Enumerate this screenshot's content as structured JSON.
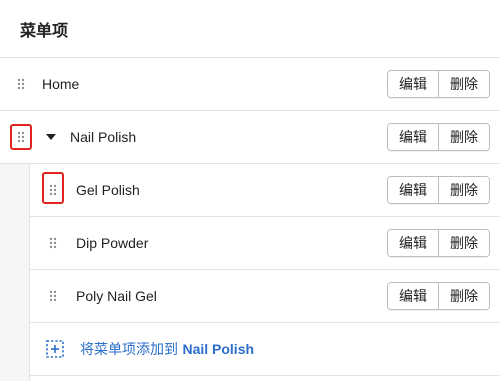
{
  "header": {
    "title": "菜单项"
  },
  "actions": {
    "edit_label": "编辑",
    "delete_label": "删除"
  },
  "items": [
    {
      "label": "Home",
      "level": 0,
      "expanded": false
    },
    {
      "label": "Nail Polish",
      "level": 0,
      "expanded": true
    },
    {
      "label": "Gel Polish",
      "level": 1
    },
    {
      "label": "Dip Powder",
      "level": 1
    },
    {
      "label": "Poly Nail Gel",
      "level": 1
    }
  ],
  "add_item": {
    "prefix": "将菜单项添加到 ",
    "target": "Nail Polish"
  },
  "colors": {
    "link": "#2c6ecb",
    "highlight": "#e02424",
    "border": "#e1e3e5"
  },
  "icons": [
    "drag-handle-icon",
    "caret-down-icon",
    "add-icon"
  ]
}
